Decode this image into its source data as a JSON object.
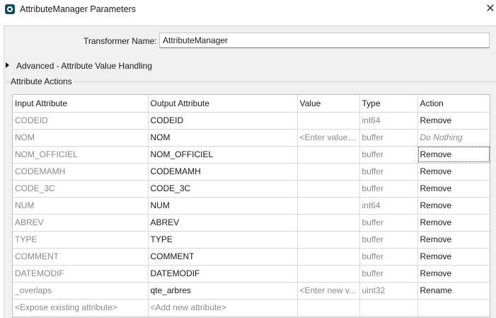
{
  "window": {
    "title": "AttributeManager Parameters",
    "close_glyph": "✕",
    "app_icon": "fme-icon"
  },
  "transformer": {
    "label": "Transformer Name:",
    "value": "AttributeManager"
  },
  "advanced": {
    "label": "Advanced - Attribute Value Handling",
    "icon": "expand-triangle-icon"
  },
  "attribute_actions": {
    "label": "Attribute Actions",
    "columns": [
      "Input Attribute",
      "Output Attribute",
      "Value",
      "Type",
      "Action"
    ],
    "rows": [
      {
        "input": "CODEID",
        "output": "CODEID",
        "value": "",
        "type": "int64",
        "action": "Remove"
      },
      {
        "input": "NOM",
        "output": "NOM",
        "value": "<Enter value ...",
        "type": "buffer",
        "action": "Do Nothing"
      },
      {
        "input": "NOM_OFFICIEL",
        "output": "NOM_OFFICIEL",
        "value": "",
        "type": "buffer",
        "action": "Remove"
      },
      {
        "input": "CODEMAMH",
        "output": "CODEMAMH",
        "value": "",
        "type": "buffer",
        "action": "Remove"
      },
      {
        "input": "CODE_3C",
        "output": "CODE_3C",
        "value": "",
        "type": "buffer",
        "action": "Remove"
      },
      {
        "input": "NUM",
        "output": "NUM",
        "value": "",
        "type": "int64",
        "action": "Remove"
      },
      {
        "input": "ABREV",
        "output": "ABREV",
        "value": "",
        "type": "buffer",
        "action": "Remove"
      },
      {
        "input": "TYPE",
        "output": "TYPE",
        "value": "",
        "type": "buffer",
        "action": "Remove"
      },
      {
        "input": "COMMENT",
        "output": "COMMENT",
        "value": "",
        "type": "buffer",
        "action": "Remove"
      },
      {
        "input": "DATEMODIF",
        "output": "DATEMODIF",
        "value": "",
        "type": "buffer",
        "action": "Remove"
      },
      {
        "input": "_overlaps",
        "output": "qte_arbres",
        "value": "<Enter new v...",
        "type": "uint32",
        "action": "Rename"
      }
    ],
    "new_row": {
      "input_placeholder": "<Expose existing attribute>",
      "output_placeholder": "<Add new attribute>"
    }
  }
}
